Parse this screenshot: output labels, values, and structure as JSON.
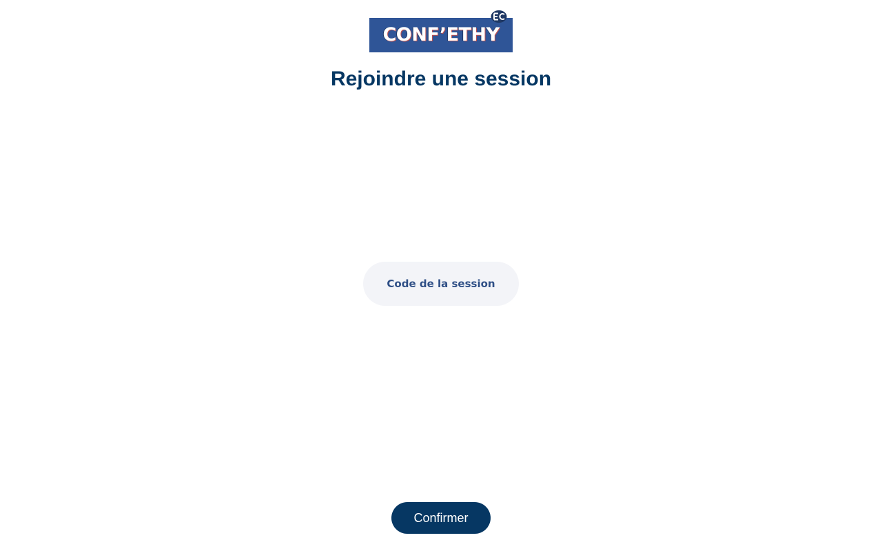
{
  "logo": {
    "text": "CONF’ETHY",
    "badge_text": "EC",
    "colors": {
      "background": "#2f5597",
      "badge": "#1f3864"
    }
  },
  "page": {
    "title": "Rejoindre une session"
  },
  "session_code": {
    "value": "",
    "placeholder": "Code de la session"
  },
  "actions": {
    "confirm_label": "Confirmer"
  },
  "colors": {
    "primary": "#063763",
    "input_background": "#f3f4f8",
    "input_text": "#2f4f86"
  }
}
